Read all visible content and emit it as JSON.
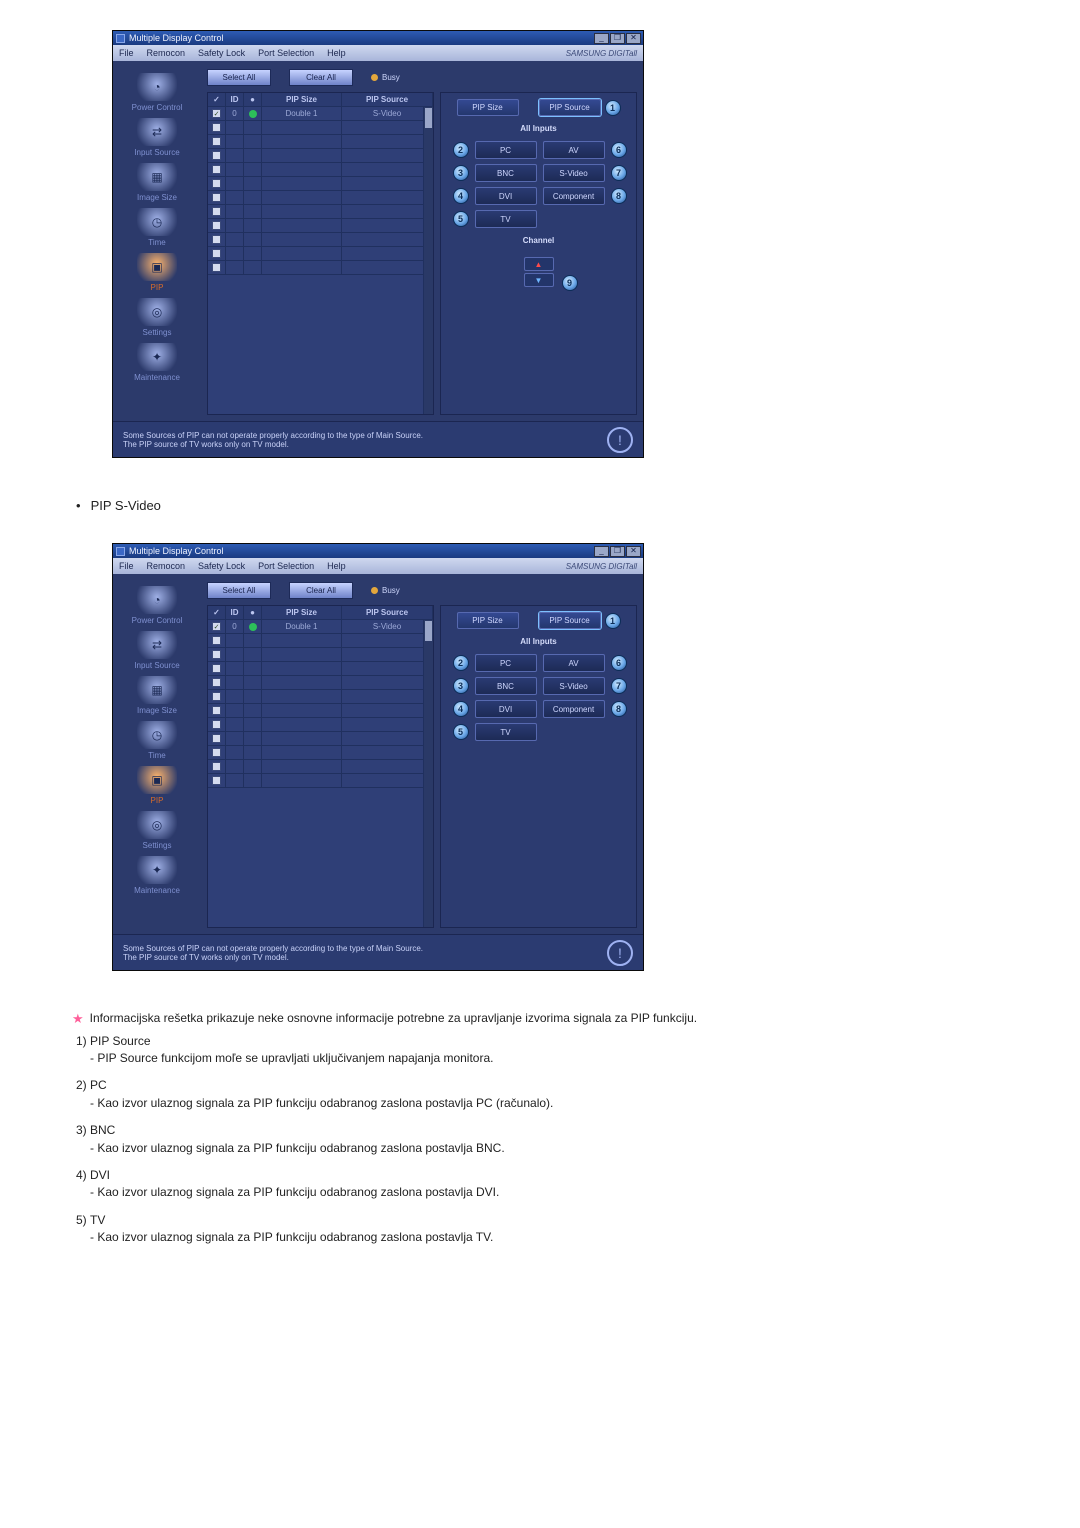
{
  "window": {
    "title": "Multiple Display Control",
    "menus": [
      "File",
      "Remocon",
      "Safety Lock",
      "Port Selection",
      "Help"
    ],
    "brand": "SAMSUNG DIGITall",
    "winbtns": {
      "min": "_",
      "max": "❐",
      "close": "✕"
    }
  },
  "sidebar": [
    {
      "label": "Power Control",
      "icon": "◔"
    },
    {
      "label": "Input Source",
      "icon": "⇄"
    },
    {
      "label": "Image Size",
      "icon": "▦"
    },
    {
      "label": "Time",
      "icon": "◷"
    },
    {
      "label": "PIP",
      "icon": "▣",
      "active": true
    },
    {
      "label": "Settings",
      "icon": "◎"
    },
    {
      "label": "Maintenance",
      "icon": "✦"
    }
  ],
  "toolbar": {
    "select_all": "Select All",
    "clear_all": "Clear All",
    "busy": "Busy"
  },
  "grid_headers": {
    "chk_icon": "✓",
    "id": "ID",
    "status_icon": "●",
    "pipsize": "PIP Size",
    "pipsrc": "PIP Source"
  },
  "grid_rows": {
    "first": {
      "id": "0",
      "pipsize": "Double 1",
      "pipsrc": "S-Video"
    },
    "blank_count": 11
  },
  "panel": {
    "top": {
      "pipsize": "PIP Size",
      "pipsource": "PIP Source",
      "ring1": "1"
    },
    "all_inputs": "All Inputs",
    "rows": [
      {
        "left_ring": "2",
        "left": "PC",
        "right": "AV",
        "right_ring": "6"
      },
      {
        "left_ring": "3",
        "left": "BNC",
        "right": "S-Video",
        "right_ring": "7"
      },
      {
        "left_ring": "4",
        "left": "DVI",
        "right": "Component",
        "right_ring": "8"
      },
      {
        "left_ring": "5",
        "left": "TV",
        "right": "",
        "right_ring": ""
      }
    ],
    "channel": {
      "title": "Channel",
      "up": "▲",
      "down": "▼",
      "ring": "9"
    }
  },
  "foot": {
    "l1": "Some Sources of PIP can not operate properly according to the type of Main Source.",
    "l2": "The PIP source of TV works only on TV model.",
    "mark": "!"
  },
  "between_heading": "PIP S-Video",
  "star_line": "Informacijska rešetka prikazuje neke osnovne informacije potrebne za upravljanje izvorima signala za PIP funkciju.",
  "list": [
    {
      "n": "1)",
      "title": "PIP Source",
      "line": "- PIP Source funkcijom moľe se upravljati uključivanjem napajanja monitora."
    },
    {
      "n": "2)",
      "title": "PC",
      "line": "- Kao izvor ulaznog signala za PIP funkciju odabranog zaslona postavlja PC (računalo)."
    },
    {
      "n": "3)",
      "title": "BNC",
      "line": "- Kao izvor ulaznog signala za PIP funkciju odabranog zaslona postavlja BNC."
    },
    {
      "n": "4)",
      "title": "DVI",
      "line": "- Kao izvor ulaznog signala za PIP funkciju odabranog zaslona postavlja DVI."
    },
    {
      "n": "5)",
      "title": "TV",
      "line": "- Kao izvor ulaznog signala za PIP funkciju odabranog zaslona postavlja TV."
    }
  ]
}
